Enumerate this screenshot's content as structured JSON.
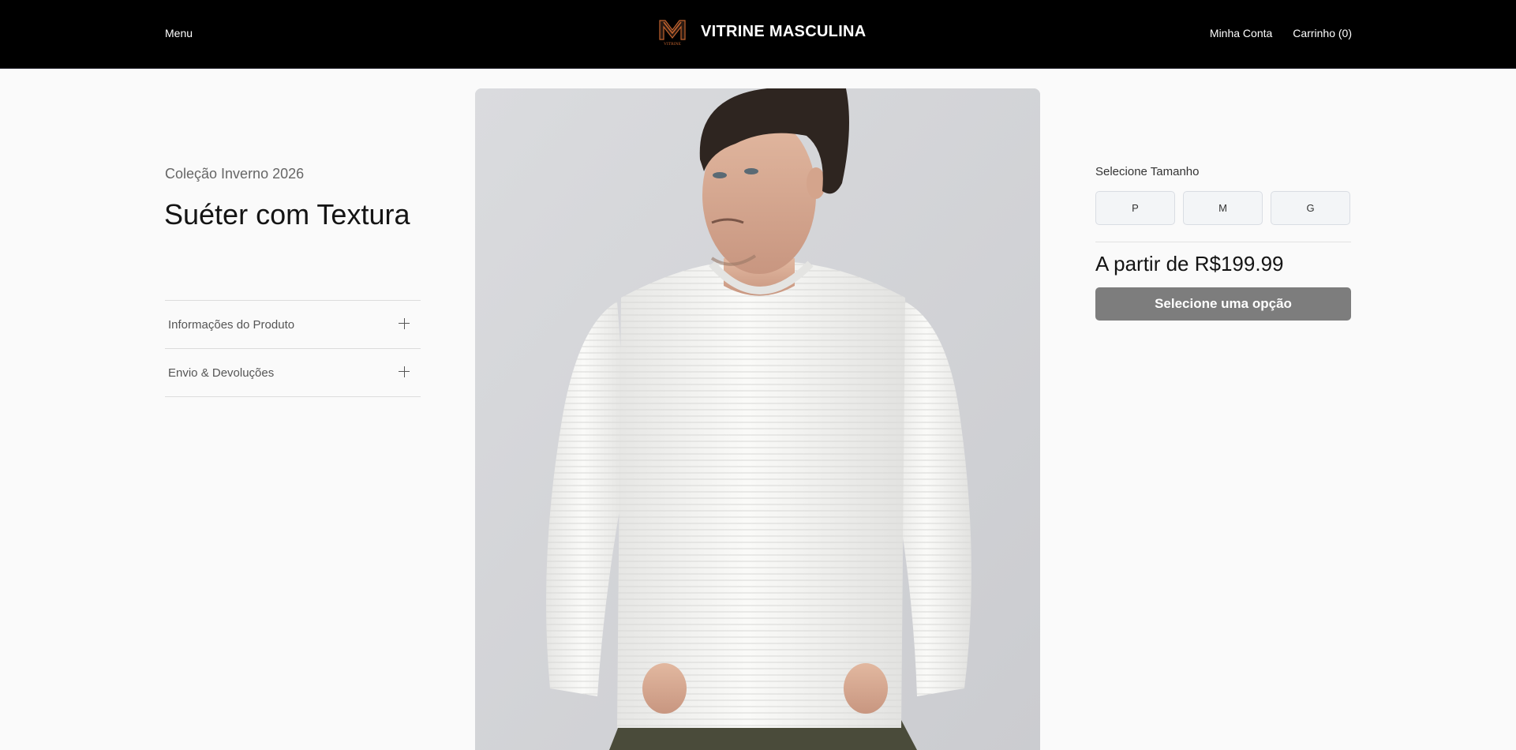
{
  "header": {
    "menu_label": "Menu",
    "brand_name": "VITRINE MASCULINA",
    "logo_text": "VITRINE",
    "account_label": "Minha Conta",
    "cart_label": "Carrinho (0)"
  },
  "product": {
    "collection": "Coleção Inverno 2026",
    "title": "Suéter com Textura",
    "accordion": [
      {
        "label": "Informações do Produto",
        "icon": "plus-icon"
      },
      {
        "label": "Envio & Devoluções",
        "icon": "plus-icon"
      }
    ],
    "size_label": "Selecione Tamanho",
    "sizes": [
      "P",
      "M",
      "G"
    ],
    "price": "A partir de R$199.99",
    "cta_label": "Selecione uma opção"
  },
  "colors": {
    "header_bg": "#000000",
    "cta_bg": "#7d7d7d",
    "logo_accent": "#c0622e"
  }
}
